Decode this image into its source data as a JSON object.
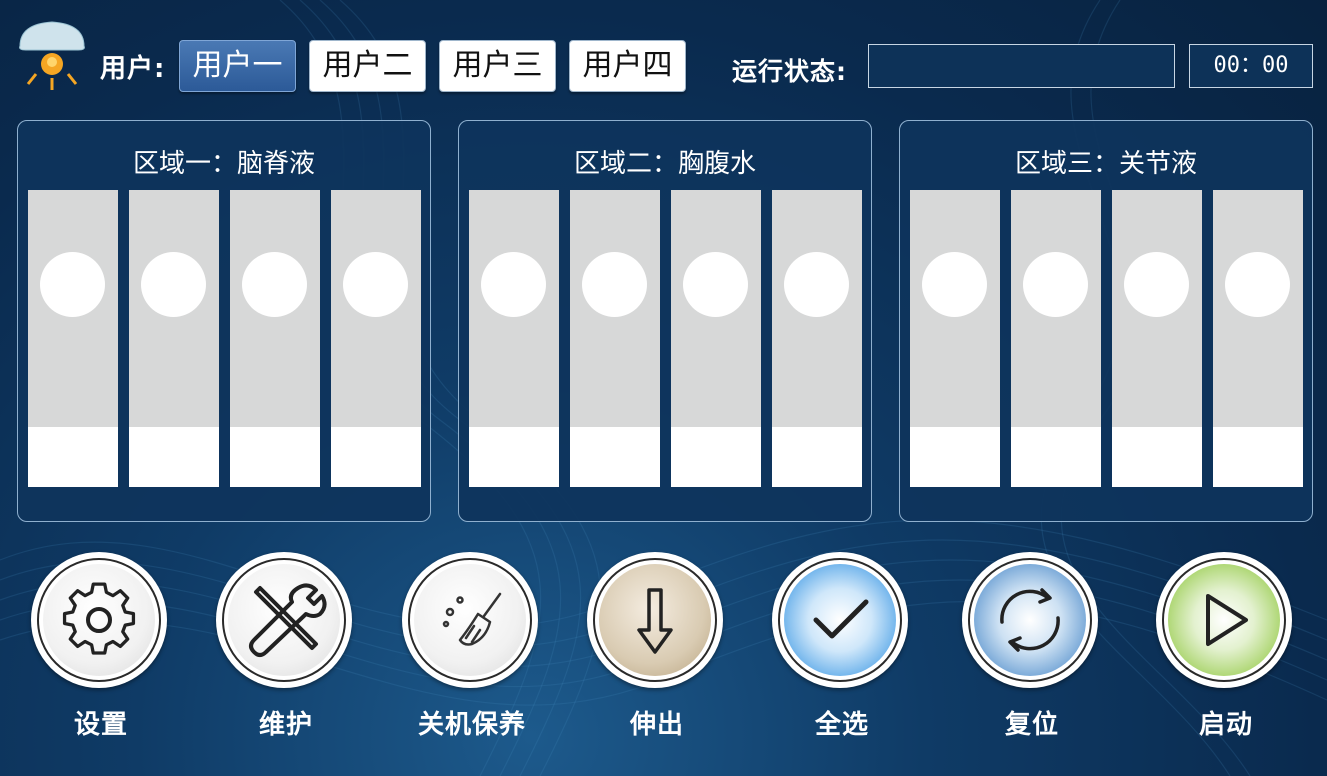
{
  "header": {
    "user_label": "用户:",
    "users": [
      "用户一",
      "用户二",
      "用户三",
      "用户四"
    ],
    "active_user": 0,
    "status_label": "运行状态:",
    "status_value": "",
    "time": "00：00"
  },
  "panels": [
    {
      "title": "区域一：脑脊液",
      "lanes": 4
    },
    {
      "title": "区域二：胸腹水",
      "lanes": 4
    },
    {
      "title": "区域三：关节液",
      "lanes": 4
    }
  ],
  "actions": [
    {
      "label": "设置",
      "icon": "gear-icon"
    },
    {
      "label": "维护",
      "icon": "wrench-screwdriver-icon"
    },
    {
      "label": "关机保养",
      "icon": "broom-icon"
    },
    {
      "label": "伸出",
      "icon": "arrow-down-icon"
    },
    {
      "label": "全选",
      "icon": "checkmark-icon"
    },
    {
      "label": "复位",
      "icon": "refresh-icon"
    },
    {
      "label": "启动",
      "icon": "play-icon"
    }
  ],
  "colors": {
    "background": "#0a2a4e",
    "panel": "#0e345c",
    "lane": "#d7d8d8",
    "active_user_button": "#3566a6",
    "confirm_blue": "#1e86d6",
    "reset_blue": "#2f6fb8",
    "start_green": "#8cc63f",
    "extend_beige": "#c9b99c"
  }
}
